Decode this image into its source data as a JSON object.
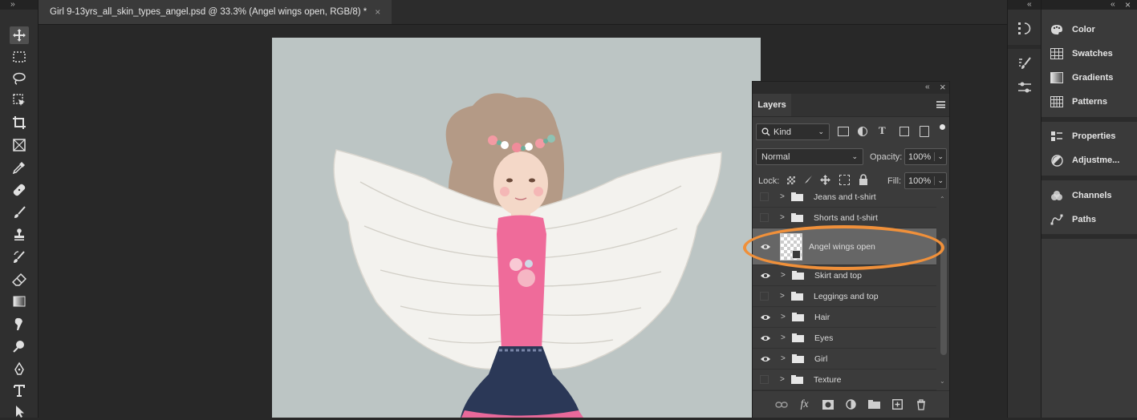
{
  "document": {
    "tab_title": "Girl 9-13yrs_all_skin_types_angel.psd @ 33.3% (Angel wings open, RGB/8) *",
    "tab_close": "×"
  },
  "toolbar": {
    "collapse": "››",
    "tools": [
      "move-tool-icon",
      "marquee-tool-icon",
      "lasso-tool-icon",
      "object-select-tool-icon",
      "crop-tool-icon",
      "frame-tool-icon",
      "eyedropper-tool-icon",
      "healing-brush-icon",
      "brush-tool-icon",
      "stamp-tool-icon",
      "history-brush-icon",
      "eraser-tool-icon",
      "gradient-tool-icon",
      "smudge-tool-icon",
      "dodge-tool-icon",
      "pen-tool-icon",
      "type-tool-icon",
      "path-select-icon"
    ]
  },
  "layers_panel": {
    "collapse": "‹‹",
    "close": "×",
    "tab_label": "Layers",
    "filter_kind": "Kind",
    "blend_mode": "Normal",
    "opacity_label": "Opacity:",
    "opacity_value": "100%",
    "lock_label": "Lock:",
    "fill_label": "Fill:",
    "fill_value": "100%",
    "layers": [
      {
        "name": "Jeans and t-shirt",
        "visible": false,
        "type": "group"
      },
      {
        "name": "Shorts and t-shirt",
        "visible": false,
        "type": "group"
      },
      {
        "name": "Angel wings open",
        "visible": true,
        "type": "smart-object",
        "selected": true
      },
      {
        "name": "Skirt and top",
        "visible": true,
        "type": "group"
      },
      {
        "name": "Leggings and top",
        "visible": false,
        "type": "group"
      },
      {
        "name": "Hair",
        "visible": true,
        "type": "group"
      },
      {
        "name": "Eyes",
        "visible": true,
        "type": "group"
      },
      {
        "name": "Girl",
        "visible": true,
        "type": "group"
      },
      {
        "name": "Texture",
        "visible": false,
        "type": "group"
      }
    ],
    "footer": {
      "fx": "fx"
    }
  },
  "right_dock": {
    "collapse": "‹‹",
    "items": [
      {
        "label": "Color",
        "icon": "palette-icon"
      },
      {
        "label": "Swatches",
        "icon": "swatches-grid-icon"
      },
      {
        "label": "Gradients",
        "icon": "gradient-icon"
      },
      {
        "label": "Patterns",
        "icon": "patterns-icon"
      },
      {
        "label": "Properties",
        "icon": "properties-icon"
      },
      {
        "label": "Adjustme...",
        "icon": "adjustments-icon"
      },
      {
        "label": "Channels",
        "icon": "channels-icon"
      },
      {
        "label": "Paths",
        "icon": "paths-icon"
      }
    ]
  },
  "colors": {
    "highlight_ring": "#f0903a",
    "canvas_bg": "#bcc5c4"
  }
}
